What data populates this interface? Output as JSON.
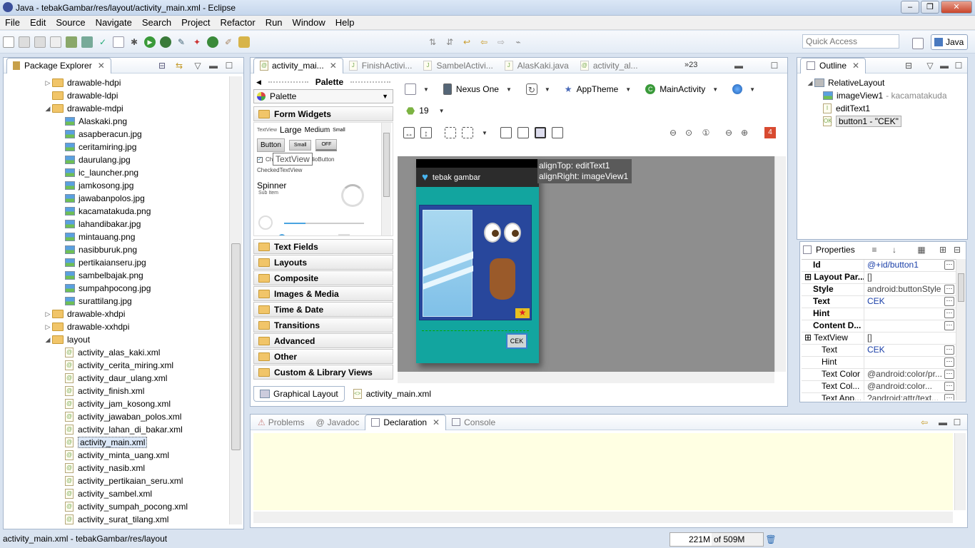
{
  "window": {
    "title": "Java - tebakGambar/res/layout/activity_main.xml - Eclipse"
  },
  "menu": [
    "File",
    "Edit",
    "Source",
    "Navigate",
    "Search",
    "Project",
    "Refactor",
    "Run",
    "Window",
    "Help"
  ],
  "quick_access": {
    "placeholder": "Quick Access"
  },
  "perspective": {
    "label": "Java"
  },
  "package_explorer": {
    "title": "Package Explorer",
    "items": [
      {
        "label": "drawable-hdpi",
        "kind": "folder",
        "depth": 1,
        "expanded": false
      },
      {
        "label": "drawable-ldpi",
        "kind": "folder",
        "depth": 1,
        "expanded": null
      },
      {
        "label": "drawable-mdpi",
        "kind": "folder",
        "depth": 1,
        "expanded": true
      },
      {
        "label": "Alaskaki.png",
        "kind": "image",
        "depth": 2
      },
      {
        "label": "asapberacun.jpg",
        "kind": "image",
        "depth": 2
      },
      {
        "label": "ceritamiring.jpg",
        "kind": "image",
        "depth": 2
      },
      {
        "label": "daurulang.jpg",
        "kind": "image",
        "depth": 2
      },
      {
        "label": "ic_launcher.png",
        "kind": "image",
        "depth": 2
      },
      {
        "label": "jamkosong.jpg",
        "kind": "image",
        "depth": 2
      },
      {
        "label": "jawabanpolos.jpg",
        "kind": "image",
        "depth": 2
      },
      {
        "label": "kacamatakuda.png",
        "kind": "image",
        "depth": 2
      },
      {
        "label": "lahandibakar.jpg",
        "kind": "image",
        "depth": 2
      },
      {
        "label": "mintauang.png",
        "kind": "image",
        "depth": 2
      },
      {
        "label": "nasibburuk.png",
        "kind": "image",
        "depth": 2
      },
      {
        "label": "pertikaianseru.jpg",
        "kind": "image",
        "depth": 2
      },
      {
        "label": "sambelbajak.png",
        "kind": "image",
        "depth": 2
      },
      {
        "label": "sumpahpocong.jpg",
        "kind": "image",
        "depth": 2
      },
      {
        "label": "surattilang.jpg",
        "kind": "image",
        "depth": 2
      },
      {
        "label": "drawable-xhdpi",
        "kind": "folder",
        "depth": 1,
        "expanded": false
      },
      {
        "label": "drawable-xxhdpi",
        "kind": "folder",
        "depth": 1,
        "expanded": false
      },
      {
        "label": "layout",
        "kind": "folder",
        "depth": 1,
        "expanded": true
      },
      {
        "label": "activity_alas_kaki.xml",
        "kind": "xml",
        "depth": 2
      },
      {
        "label": "activity_cerita_miring.xml",
        "kind": "xml",
        "depth": 2
      },
      {
        "label": "activity_daur_ulang.xml",
        "kind": "xml",
        "depth": 2
      },
      {
        "label": "activity_finish.xml",
        "kind": "xml",
        "depth": 2
      },
      {
        "label": "activity_jam_kosong.xml",
        "kind": "xml",
        "depth": 2
      },
      {
        "label": "activity_jawaban_polos.xml",
        "kind": "xml",
        "depth": 2
      },
      {
        "label": "activity_lahan_di_bakar.xml",
        "kind": "xml",
        "depth": 2
      },
      {
        "label": "activity_main.xml",
        "kind": "xml",
        "depth": 2,
        "selected": true
      },
      {
        "label": "activity_minta_uang.xml",
        "kind": "xml",
        "depth": 2
      },
      {
        "label": "activity_nasib.xml",
        "kind": "xml",
        "depth": 2
      },
      {
        "label": "activity_pertikaian_seru.xml",
        "kind": "xml",
        "depth": 2
      },
      {
        "label": "activity_sambel.xml",
        "kind": "xml",
        "depth": 2
      },
      {
        "label": "activity_sumpah_pocong.xml",
        "kind": "xml",
        "depth": 2
      },
      {
        "label": "activity_surat_tilang.xml",
        "kind": "xml",
        "depth": 2
      }
    ]
  },
  "editor": {
    "tabs": [
      "activity_mai...",
      "FinishActivi...",
      "SambelActivi...",
      "AlasKaki.java",
      "activity_al..."
    ],
    "overflow": "»23",
    "palette": {
      "title": "Palette",
      "dropdown": "Palette",
      "categories": [
        "Form Widgets",
        "Text Fields",
        "Layouts",
        "Composite",
        "Images & Media",
        "Time & Date",
        "Transitions",
        "Advanced",
        "Other",
        "Custom & Library Views"
      ],
      "widgets": {
        "textview_small": "TextView",
        "large": "Large",
        "medium": "Medium",
        "small": "Small",
        "button": "Button",
        "small_button": "Small",
        "toggle": "OFF",
        "tooltip": "TextView",
        "checkbox": "CheckBox",
        "radio": "RadioButton",
        "checked_textview": "CheckedTextView",
        "spinner": "Spinner",
        "sub_item": "Sub Item"
      }
    },
    "toolbar": {
      "device": "Nexus One",
      "theme": "AppTheme",
      "activity": "MainActivity",
      "api": "19",
      "error_count": "4"
    },
    "device_preview": {
      "app_title": "tebak gambar",
      "button_label": "CEK",
      "hint_text": "alignTop: editText1",
      "hint_text2": "alignRight: imageView1"
    },
    "bottom_tabs": [
      "Graphical Layout",
      "activity_main.xml"
    ]
  },
  "outline": {
    "title": "Outline",
    "items": [
      "RelativeLayout",
      "imageView1",
      "- kacamatakuda",
      "editText1",
      "button1 - \"CEK\""
    ]
  },
  "properties": {
    "title": "Properties",
    "rows": [
      {
        "k": "Id",
        "v": "@+id/button1",
        "bold": true,
        "blue": true
      },
      {
        "k": "Layout Par...",
        "v": "[]",
        "bold": true,
        "expand": true
      },
      {
        "k": "Style",
        "v": "android:buttonStyle",
        "bold": true
      },
      {
        "k": "Text",
        "v": "CEK",
        "bold": true,
        "blue": true
      },
      {
        "k": "Hint",
        "v": "",
        "bold": true
      },
      {
        "k": "Content D...",
        "v": "",
        "bold": true
      },
      {
        "k": "TextView",
        "v": "[]",
        "bold": false,
        "expand": true
      },
      {
        "k": "Text",
        "v": "CEK",
        "bold": false,
        "blue": true,
        "indent": true
      },
      {
        "k": "Hint",
        "v": "",
        "bold": false,
        "indent": true
      },
      {
        "k": "Text Color",
        "v": "@android:color/pr...",
        "bold": false,
        "indent": true
      },
      {
        "k": "Text Col...",
        "v": "@android:color...",
        "bold": false,
        "indent": true
      },
      {
        "k": "Text App...",
        "v": "?android:attr/text...",
        "bold": false,
        "indent": true
      }
    ]
  },
  "bottom_panel": {
    "tabs": [
      "Problems",
      "Javadoc",
      "Declaration",
      "Console"
    ],
    "active": "Declaration"
  },
  "status": {
    "path": "activity_main.xml - tebakGambar/res/layout",
    "heap_used": "221M",
    "heap_total": "of 509M"
  },
  "colors": {
    "accent": "#2e6db4",
    "teal": "#13a9a4",
    "phone_blue": "#28479c",
    "error": "#d84a30"
  }
}
